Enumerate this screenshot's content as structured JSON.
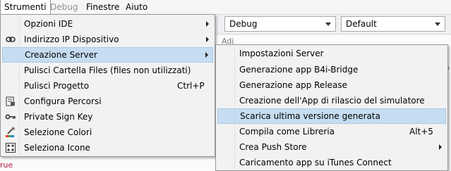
{
  "menubar": {
    "items": [
      {
        "label": "Strumenti",
        "state": "active"
      },
      {
        "label": "Debug",
        "state": "disabled"
      },
      {
        "label": "Finestre",
        "state": "normal"
      },
      {
        "label": "Aiuto",
        "state": "normal"
      }
    ]
  },
  "toolbar": {
    "config_combo": "Debug",
    "theme_combo": "Default"
  },
  "background": {
    "partial_text": "Adj",
    "partial_text2": "b",
    "red_text": "rue"
  },
  "main_menu": {
    "items": [
      {
        "label": "Opzioni IDE",
        "icon": "none",
        "shortcut": "",
        "submenu": true
      },
      {
        "label": "Indirizzo IP Dispositivo",
        "icon": "link-icon",
        "shortcut": "",
        "submenu": true
      },
      {
        "label": "Creazione Server",
        "icon": "none",
        "shortcut": "",
        "submenu": true,
        "highlighted": true
      },
      {
        "label": "Pulisci Cartella Files (files non utilizzati)",
        "icon": "none",
        "shortcut": "",
        "submenu": false
      },
      {
        "label": "Pulisci Progetto",
        "icon": "none",
        "shortcut": "Ctrl+P",
        "submenu": false
      },
      {
        "label": "Configura Percorsi",
        "icon": "configure-paths-icon",
        "shortcut": "",
        "submenu": false
      },
      {
        "label": "Private Sign Key",
        "icon": "key-icon",
        "shortcut": "",
        "submenu": false
      },
      {
        "label": "Selezione Colori",
        "icon": "color-picker-icon",
        "shortcut": "",
        "submenu": false
      },
      {
        "label": "Seleziona Icone",
        "icon": "icon-grid-icon",
        "shortcut": "",
        "submenu": false
      }
    ]
  },
  "sub_menu": {
    "items": [
      {
        "label": "Impostazioni Server",
        "shortcut": "",
        "submenu": false
      },
      {
        "label": "Generazione app B4i-Bridge",
        "shortcut": "",
        "submenu": false
      },
      {
        "label": "Generazione app Release",
        "shortcut": "",
        "submenu": false
      },
      {
        "label": "Creazione dell'App di rilascio del simulatore",
        "shortcut": "",
        "submenu": false
      },
      {
        "label": "Scarica ultima versione generata",
        "shortcut": "",
        "submenu": false,
        "highlighted": true
      },
      {
        "label": "Compila come Libreria",
        "shortcut": "Alt+5",
        "submenu": false
      },
      {
        "label": "Crea Push Store",
        "shortcut": "",
        "submenu": true
      },
      {
        "label": "Caricamento app su iTunes Connect",
        "shortcut": "",
        "submenu": false
      }
    ]
  }
}
